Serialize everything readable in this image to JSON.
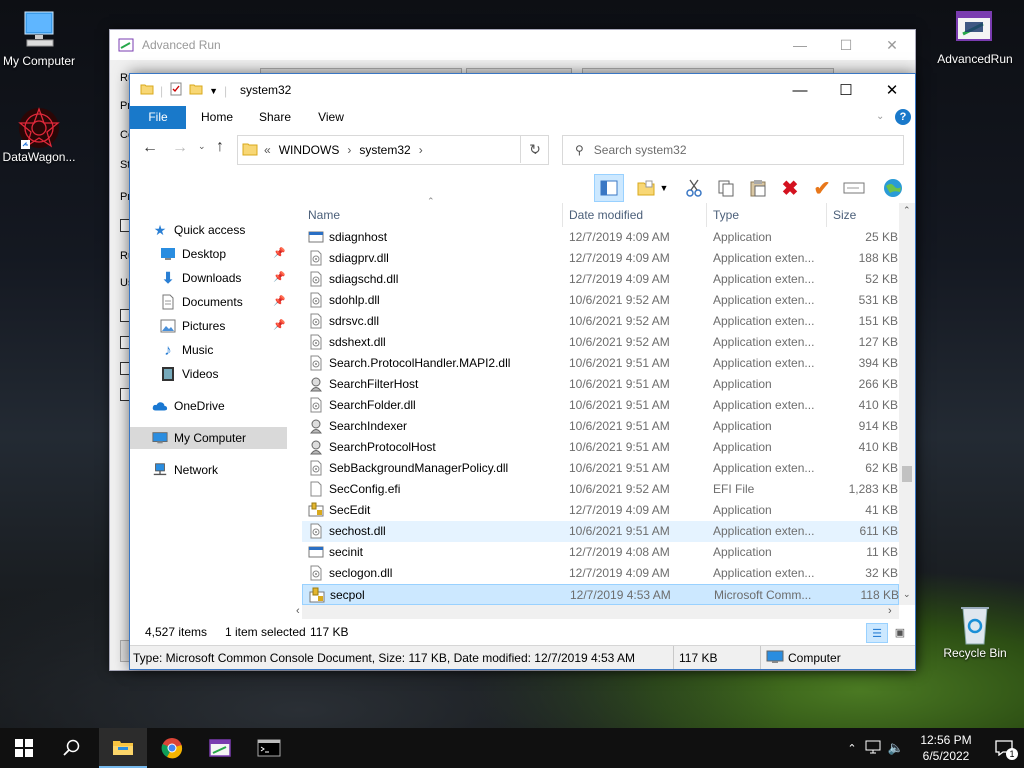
{
  "desktop": {
    "icons": [
      {
        "label": "My Computer"
      },
      {
        "label": "DataWagon..."
      },
      {
        "label": "AdvancedRun"
      },
      {
        "label": "Recycle Bin"
      }
    ]
  },
  "advanced_run": {
    "title": "Advanced Run",
    "left_labels": [
      "Ru",
      "Pr",
      "Co",
      "St",
      "Pr",
      "Ru",
      "Us"
    ]
  },
  "explorer": {
    "title": "system32",
    "tabs": {
      "file": "File",
      "home": "Home",
      "share": "Share",
      "view": "View"
    },
    "address": {
      "prefix": "«",
      "part1": "WINDOWS",
      "part2": "system32"
    },
    "search_placeholder": "Search system32",
    "nav": {
      "quick_access": "Quick access",
      "desktop": "Desktop",
      "downloads": "Downloads",
      "documents": "Documents",
      "pictures": "Pictures",
      "music": "Music",
      "videos": "Videos",
      "onedrive": "OneDrive",
      "my_computer": "My Computer",
      "network": "Network"
    },
    "columns": {
      "name": "Name",
      "date": "Date modified",
      "type": "Type",
      "size": "Size"
    },
    "files": [
      {
        "name": "sdiagnhost",
        "date": "12/7/2019 4:09 AM",
        "type": "Application",
        "size": "25 KB",
        "icon": "app"
      },
      {
        "name": "sdiagprv.dll",
        "date": "12/7/2019 4:09 AM",
        "type": "Application exten...",
        "size": "188 KB",
        "icon": "dll"
      },
      {
        "name": "sdiagschd.dll",
        "date": "12/7/2019 4:09 AM",
        "type": "Application exten...",
        "size": "52 KB",
        "icon": "dll"
      },
      {
        "name": "sdohlp.dll",
        "date": "10/6/2021 9:52 AM",
        "type": "Application exten...",
        "size": "531 KB",
        "icon": "dll"
      },
      {
        "name": "sdrsvc.dll",
        "date": "10/6/2021 9:52 AM",
        "type": "Application exten...",
        "size": "151 KB",
        "icon": "dll"
      },
      {
        "name": "sdshext.dll",
        "date": "10/6/2021 9:52 AM",
        "type": "Application exten...",
        "size": "127 KB",
        "icon": "dll"
      },
      {
        "name": "Search.ProtocolHandler.MAPI2.dll",
        "date": "10/6/2021 9:51 AM",
        "type": "Application exten...",
        "size": "394 KB",
        "icon": "dll"
      },
      {
        "name": "SearchFilterHost",
        "date": "10/6/2021 9:51 AM",
        "type": "Application",
        "size": "266 KB",
        "icon": "search"
      },
      {
        "name": "SearchFolder.dll",
        "date": "10/6/2021 9:51 AM",
        "type": "Application exten...",
        "size": "410 KB",
        "icon": "dll"
      },
      {
        "name": "SearchIndexer",
        "date": "10/6/2021 9:51 AM",
        "type": "Application",
        "size": "914 KB",
        "icon": "search"
      },
      {
        "name": "SearchProtocolHost",
        "date": "10/6/2021 9:51 AM",
        "type": "Application",
        "size": "410 KB",
        "icon": "search"
      },
      {
        "name": "SebBackgroundManagerPolicy.dll",
        "date": "10/6/2021 9:51 AM",
        "type": "Application exten...",
        "size": "62 KB",
        "icon": "dll"
      },
      {
        "name": "SecConfig.efi",
        "date": "10/6/2021 9:52 AM",
        "type": "EFI File",
        "size": "1,283 KB",
        "icon": "file"
      },
      {
        "name": "SecEdit",
        "date": "12/7/2019 4:09 AM",
        "type": "Application",
        "size": "41 KB",
        "icon": "secedit"
      },
      {
        "name": "sechost.dll",
        "date": "10/6/2021 9:51 AM",
        "type": "Application exten...",
        "size": "611 KB",
        "icon": "dll",
        "state": "hl"
      },
      {
        "name": "secinit",
        "date": "12/7/2019 4:08 AM",
        "type": "Application",
        "size": "11 KB",
        "icon": "app"
      },
      {
        "name": "seclogon.dll",
        "date": "12/7/2019 4:09 AM",
        "type": "Application exten...",
        "size": "32 KB",
        "icon": "dll"
      },
      {
        "name": "secpol",
        "date": "12/7/2019 4:53 AM",
        "type": "Microsoft Comm...",
        "size": "118 KB",
        "icon": "secpol",
        "state": "sel"
      }
    ],
    "status": {
      "items": "4,527 items",
      "selected": "1 item selected",
      "size": "117 KB"
    },
    "details_bar": {
      "text": "Type: Microsoft Common Console Document, Size: 117 KB, Date modified: 12/7/2019 4:53 AM",
      "size": "117 KB",
      "location": "Computer"
    }
  },
  "taskbar": {
    "time": "12:56 PM",
    "date": "6/5/2022",
    "notification_count": "1"
  }
}
